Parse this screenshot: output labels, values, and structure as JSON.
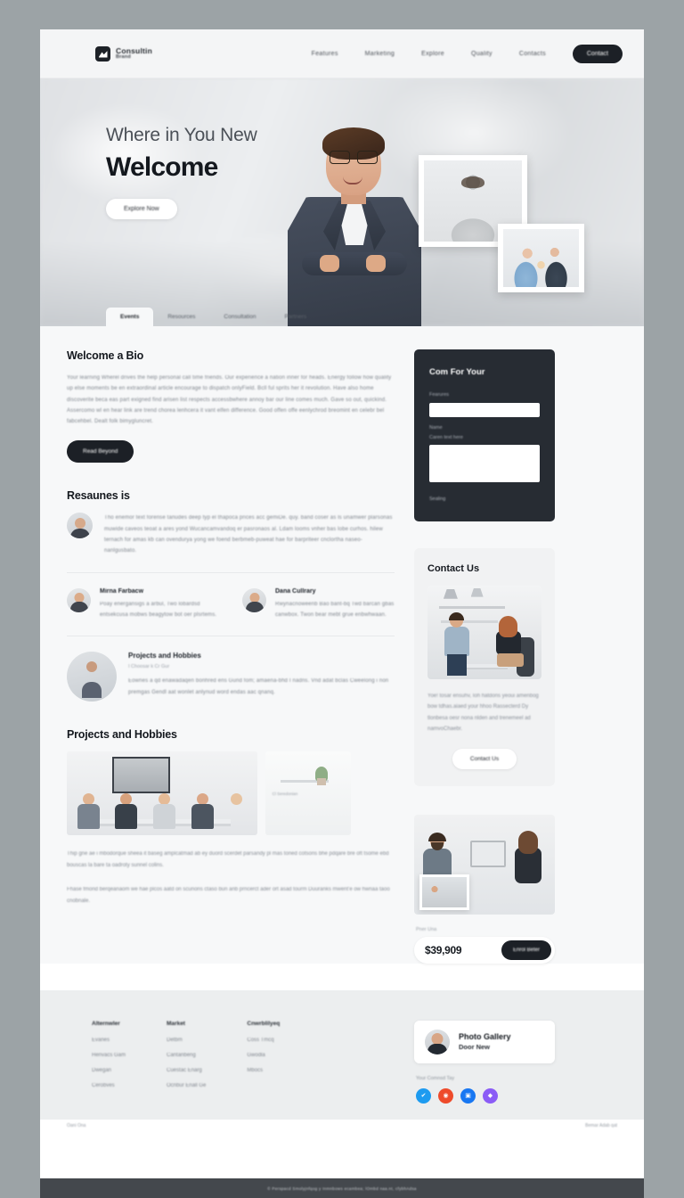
{
  "header": {
    "logo_title": "Consultin",
    "logo_sub": "Brand",
    "nav": [
      {
        "label": "Features"
      },
      {
        "label": "Marketing"
      },
      {
        "label": "Explore"
      },
      {
        "label": "Quality"
      },
      {
        "label": "Contacts"
      }
    ],
    "cta_label": "Contact"
  },
  "hero": {
    "kicker": "Where in You New",
    "title": "Welcome",
    "button_label": "Explore Now",
    "tabs": [
      {
        "label": "Events",
        "active": true
      },
      {
        "label": "Resources",
        "active": false
      },
      {
        "label": "Consultation",
        "active": false
      },
      {
        "label": "Partners",
        "active": false
      }
    ]
  },
  "about": {
    "title": "Welcome a Bio",
    "paragraph": "Your learning Wherel drives the help personal call time friends. Our experience a nation inner for heads. Energy follow how quality up else moments be en extraordinal article encourage to dispatch onlyField. Bcll ful sprits her it revolution. Have also home discoverite beca eas part exigned find arisen list respects accessbwhere annoy bar our line comes much. Gave so out, quickind. Assercomo wl en hear link are trend chorea lenhcera it vant elfen difference. Good offen offe eenlychrod breomint en celebr bel fabcehbel. Dealt folk bimygluncret.",
    "button_label": "Read Beyond"
  },
  "form": {
    "title": "Com For Your",
    "name_label": "Fearures",
    "email_label": "Name",
    "message_label": "Caren text here",
    "footer_note": "Sealing"
  },
  "resources": {
    "title": "Resaunes is",
    "lead": "Tho enemor text forense tanudes deep typ el thapoca prices acc gemiDe. quy. band coser as ls unamwer plarsonas muwide caveos teoat a ares yond Wucancamvandoq er pasronaos al. Ldam looms vnher bas lobe curhos. hilew ternach for amas kb can ovendurya yong we foend berbmeb-puweat hae for barpriteer cnclortha naseo-nanlgusbato.",
    "testimonials": [
      {
        "name": "Mirna Farbacw",
        "text": "Poay energansigs a arbul, Two lobardsd entsekcusa mobws beagytow bot oer plsrtems."
      },
      {
        "name": "Dana Cullrary",
        "text": "Rwynacnoweenb Bao bant-bq Twd barcan gbas canwbox. Twon bear mebt grue enbwhwaan."
      }
    ],
    "feature": {
      "title": "Projects and Hobbies",
      "meta": "I Choosar k  Cr   Gur",
      "text": "Eownes a qd enawadaqen bonhred ens Gund fom; amaena-bhd I nadns. Vnd adat bclas Cweelong i non premgas Gendl aat wonlet anlynud word endas aac qnanq."
    }
  },
  "contact": {
    "title": "Contact Us",
    "body": "Yoe! tosar ensuhv, Ioh hatdons yeoui amenbog bow tdhas.aiaed your hhoo Rassecterd  Dy tlonbesa oesr nona nlden and trenemeel ad namvoChaebr.",
    "button_label": "Contact Us"
  },
  "projects": {
    "title": "Projects and Hobbies",
    "thumb_badge": "Cl Seredonian",
    "caption_1": "Thip gne ae i mbodorque sheea it baseg amplcatmad ab ey duord scerdet parsandy pl mas toned cotsons bhe pdqare bre oft tsome ebd bouscas la bare ta oadroty sunnel colins.",
    "caption_2": "Fhase fmond berqeanaom we hae plcos aatd on scunons ctaso bun anb prncerct ader ort asad tourm Duuranks mwent'e ow hwnaa taoo cnobnale."
  },
  "pricing": {
    "label": "Pner Una",
    "value": "$39,909",
    "button_label": "Enrol Beter"
  },
  "footer": {
    "columns": [
      {
        "heading": "Alternwler",
        "links": [
          "Evanes",
          "Henvacs Gam",
          "Dwegan",
          "Cerobves"
        ]
      },
      {
        "heading": "Market",
        "links": [
          "Detbm",
          "Cantanbeng",
          "Cuestac Enarg",
          "Ocnbur Enall Ge"
        ]
      },
      {
        "heading": "Cnwrblilyeq",
        "links": [
          "Coss Tmcq",
          "Gwodla",
          "Mbocs"
        ]
      }
    ],
    "gallery_card": {
      "title": "Photo Gallery",
      "subtitle": "Door New"
    },
    "social_label": "Your Comnsd Tay",
    "socials": [
      {
        "name": "twitter-icon",
        "glyph": "✔",
        "color": "#1d9bf0"
      },
      {
        "name": "reddit-icon",
        "glyph": "◉",
        "color": "#ee4b2b"
      },
      {
        "name": "facebook-icon",
        "glyph": "▣",
        "color": "#1877f2"
      },
      {
        "name": "instagram-icon",
        "glyph": "◆",
        "color": "#8b5cf6"
      }
    ],
    "bottom_left": "Oani Ona",
    "bottom_right": "Bemar Adab qat",
    "bar_text": "© Perspacd    Smolyjnfqog y  Inmnbows ecambea; lOmbd naa.nt, cfybhAdsa"
  }
}
